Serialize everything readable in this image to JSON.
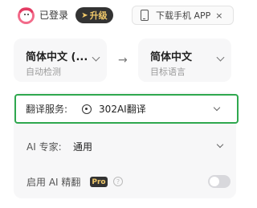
{
  "header": {
    "login_label": "已登录",
    "upgrade_label": "升级",
    "download_label": "下载手机 APP",
    "close_glyph": "×"
  },
  "languages": {
    "source": {
      "name": "简体中文 (...",
      "sub": "自动检测"
    },
    "target": {
      "name": "简体中文",
      "sub": "目标语言"
    },
    "swap_glyph": "→"
  },
  "settings": {
    "service": {
      "label": "翻译服务:",
      "value": "302AI翻译",
      "icon": "service-logo-icon"
    },
    "expert": {
      "label": "AI 专家:",
      "value": "通用"
    },
    "fine_translate": {
      "label": "启用 AI 精翻",
      "badge": "Pro",
      "help": "?",
      "enabled": false
    }
  },
  "colors": {
    "accent_border": "#2fa84f",
    "badge_bg": "#333333",
    "badge_text": "#f1c96a"
  }
}
